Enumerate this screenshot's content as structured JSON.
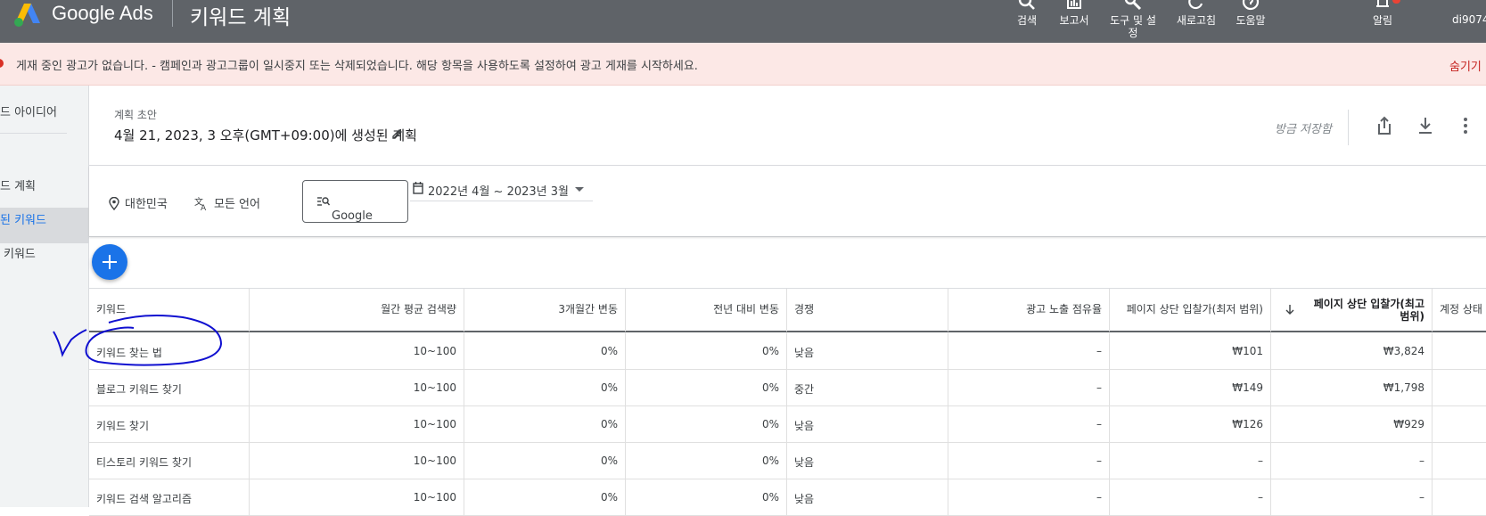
{
  "header": {
    "brand": "Google Ads",
    "page_title": "키워드 계획",
    "tools": [
      {
        "label": "검색",
        "icon": "search-icon"
      },
      {
        "label": "보고서",
        "icon": "reports-icon"
      },
      {
        "label": "도구 및 설\n정",
        "icon": "tools-icon"
      },
      {
        "label": "새로고침",
        "icon": "refresh-icon"
      },
      {
        "label": "도움말",
        "icon": "help-icon"
      },
      {
        "label": "알림",
        "icon": "bell-icon"
      }
    ],
    "account": "di9074"
  },
  "alert": {
    "message": "게재 중인 광고가 없습니다. - 캠페인과 광고그룹이 일시중지 또는 삭제되었습니다. 해당 항목을 사용하도록 설정하여 광고 게재를 시작하세요.",
    "hide": "숨기기"
  },
  "sidebar": {
    "items": [
      {
        "label": "드 아이디어"
      },
      {
        "label": "드 계획"
      },
      {
        "label": "된 키워드"
      },
      {
        "label": "키워드"
      }
    ]
  },
  "plan": {
    "label": "계획 초안",
    "name": "4월 21, 2023, 3 오후(GMT+09:00)에 생성된 계획",
    "saved": "방금 저장함"
  },
  "filters": {
    "location": "대한민국",
    "language": "모든 언어",
    "network": "Google",
    "date_range": "2022년 4월 ~ 2023년 3월"
  },
  "table": {
    "columns": [
      "키워드",
      "월간 평균 검색량",
      "3개월간 변동",
      "전년 대비 변동",
      "경쟁",
      "광고 노출 점유율",
      "페이지 상단 입찰가(최저 범위)",
      "페이지 상단 입찰가(최고\n범위)",
      "계정 상태"
    ],
    "rows": [
      [
        "키워드 찾는 법",
        "10~100",
        "0%",
        "0%",
        "낮음",
        "–",
        "₩101",
        "₩3,824",
        ""
      ],
      [
        "블로그 키워드 찾기",
        "10~100",
        "0%",
        "0%",
        "중간",
        "–",
        "₩149",
        "₩1,798",
        ""
      ],
      [
        "키워드 찾기",
        "10~100",
        "0%",
        "0%",
        "낮음",
        "–",
        "₩126",
        "₩929",
        ""
      ],
      [
        "티스토리 키워드 찾기",
        "10~100",
        "0%",
        "0%",
        "낮음",
        "–",
        "–",
        "–",
        ""
      ],
      [
        "키워드 검색 알고리즘",
        "10~100",
        "0%",
        "0%",
        "낮음",
        "–",
        "–",
        "–",
        ""
      ]
    ]
  },
  "colors": {
    "topbar": "#5f6368",
    "alert_bg": "#fce8e6",
    "accent": "#1a73e8",
    "annotation": "#1010d0"
  }
}
